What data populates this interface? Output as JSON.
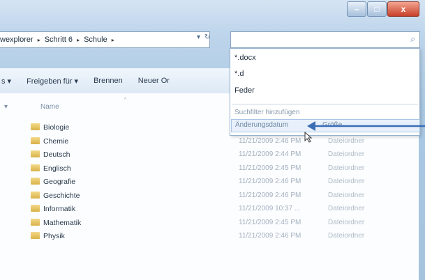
{
  "window": {
    "min": "–",
    "max": "□",
    "close": "x"
  },
  "address": {
    "segments": [
      "wexplorer",
      "Schritt 6",
      "Schule"
    ],
    "separator": "▸",
    "dropdown_glyph": "▾",
    "refresh_glyph": "↻"
  },
  "search": {
    "icon": "search-icon",
    "glyph": "⌕"
  },
  "toolbar": {
    "stub": "s ▾",
    "share": "Freigeben für ▾",
    "burn": "Brennen",
    "new_folder": "Neuer Or"
  },
  "columns": {
    "stub": "▾",
    "name": "Name",
    "sort": "^"
  },
  "files": [
    {
      "name": "Biologie",
      "date": "",
      "type": ""
    },
    {
      "name": "Chemie",
      "date": "11/21/2009 2:46 PM",
      "type": "Dateiordner"
    },
    {
      "name": "Deutsch",
      "date": "11/21/2009 2:44 PM",
      "type": "Dateiordner"
    },
    {
      "name": "Englisch",
      "date": "11/21/2009 2:45 PM",
      "type": "Dateiordner"
    },
    {
      "name": "Geografie",
      "date": "11/21/2009 2:46 PM",
      "type": "Dateiordner"
    },
    {
      "name": "Geschichte",
      "date": "11/21/2009 2:46 PM",
      "type": "Dateiordner"
    },
    {
      "name": "Informatik",
      "date": "11/21/2009 10:37 ...",
      "type": "Dateiordner"
    },
    {
      "name": "Mathematik",
      "date": "11/21/2009 2:45 PM",
      "type": "Dateiordner"
    },
    {
      "name": "Physik",
      "date": "11/21/2009 2:46 PM",
      "type": "Dateiordner"
    }
  ],
  "dropdown": {
    "items": [
      "*.docx",
      "*.d",
      "Feder"
    ],
    "filter_label": "Suchfilter hinzufügen",
    "filter_a": "Änderungsdatum",
    "filter_b": "Größe"
  },
  "colors": {
    "annotation_arrow": "#3b6db5",
    "window_frame": "#a9c8e3"
  }
}
